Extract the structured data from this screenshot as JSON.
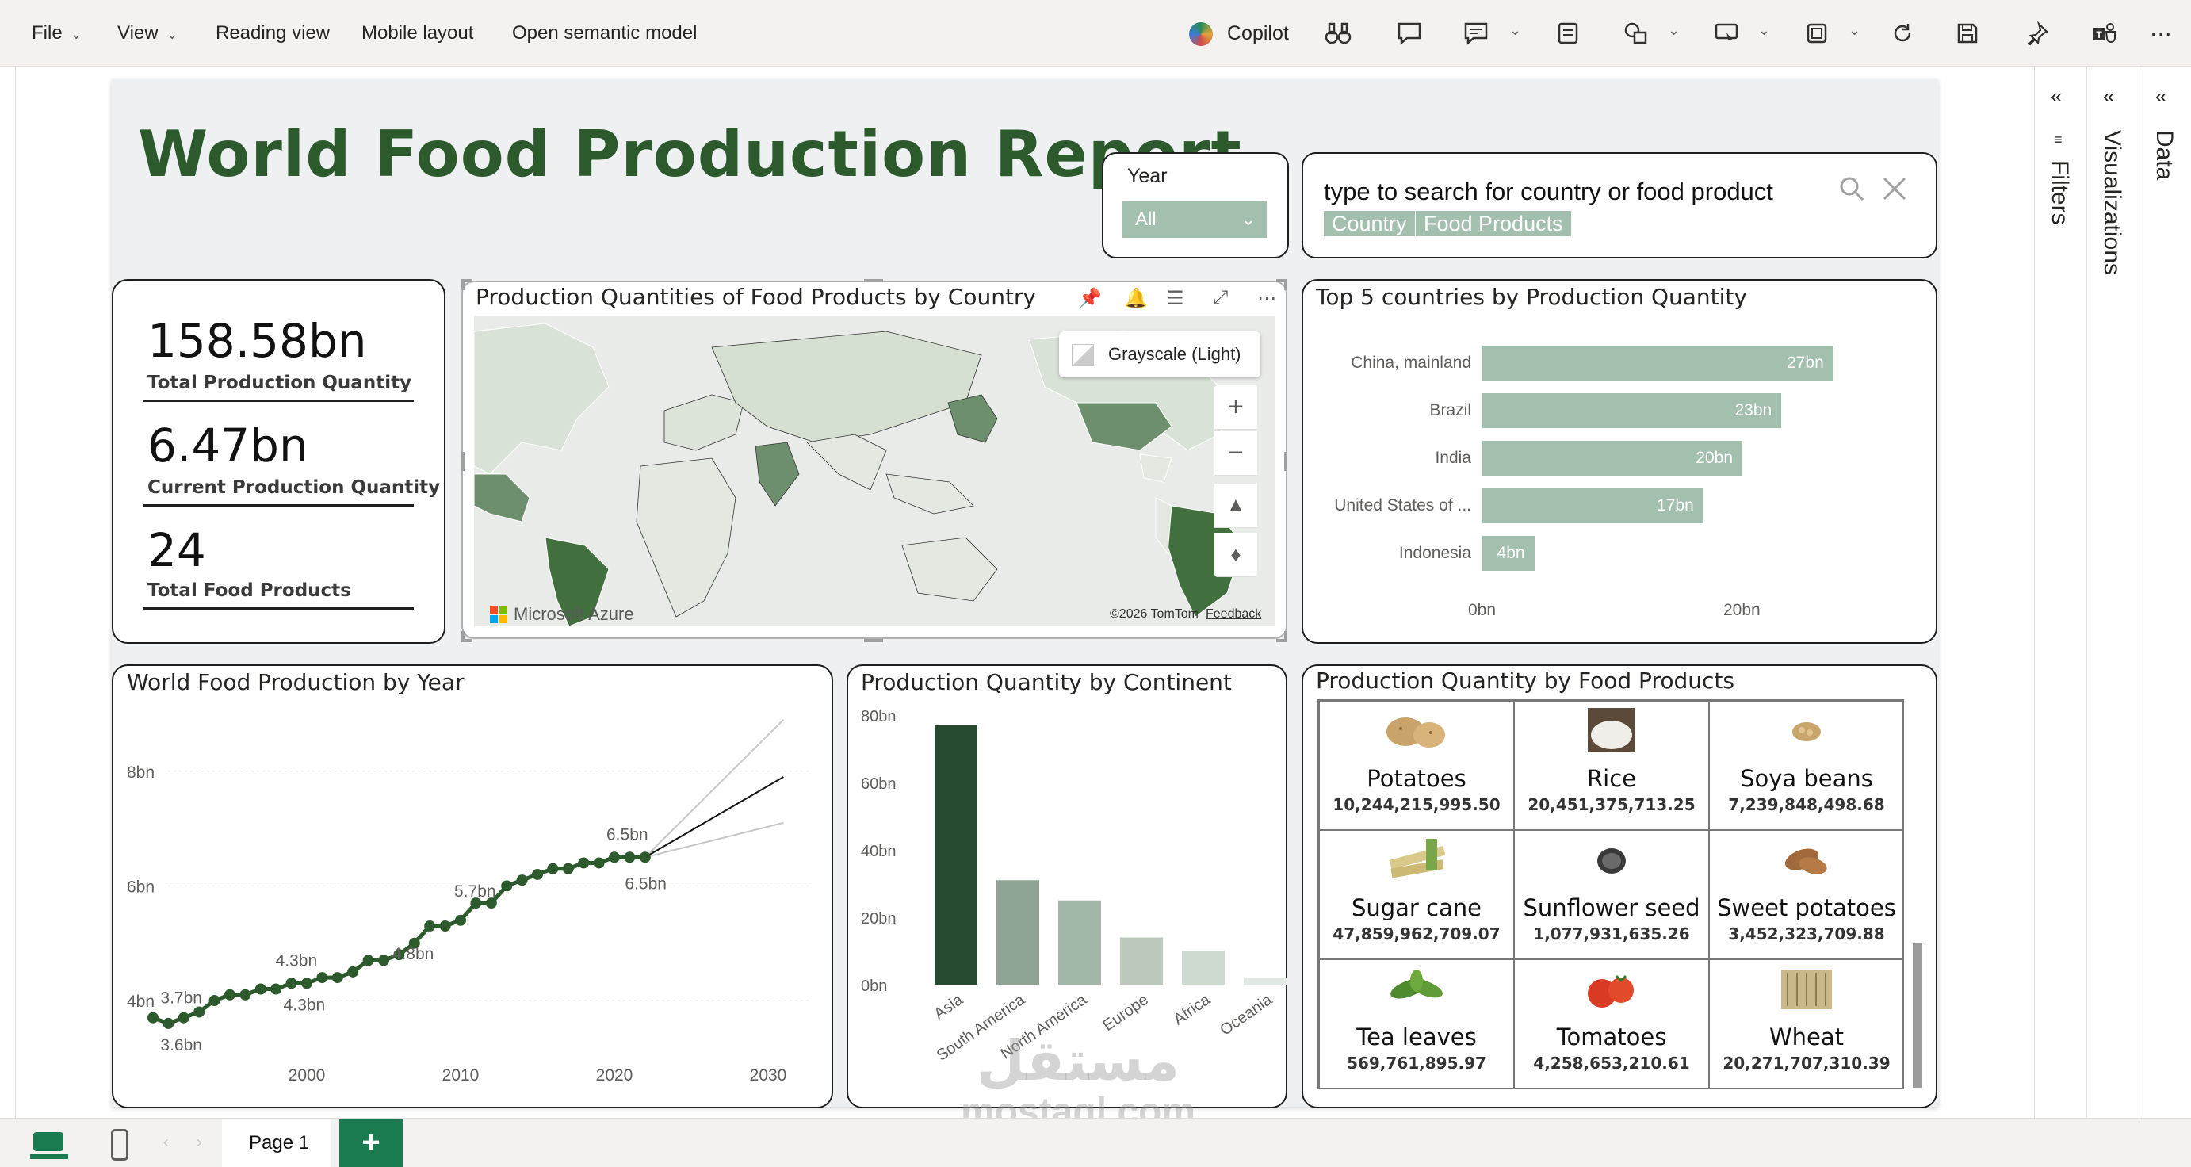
{
  "menu": {
    "file": "File",
    "view": "View",
    "reading_view": "Reading view",
    "mobile_layout": "Mobile layout",
    "open_semantic_model": "Open semantic model",
    "copilot": "Copilot"
  },
  "report": {
    "title": "World Food Production Report"
  },
  "year_slicer": {
    "label": "Year",
    "selected": "All"
  },
  "search": {
    "placeholder": "type to search for country or food product",
    "chips": [
      "Country",
      "Food Products"
    ]
  },
  "kpis": [
    {
      "value": "158.58bn",
      "label": "Total Production Quantity"
    },
    {
      "value": "6.47bn",
      "label": "Current Production Quantity"
    },
    {
      "value": "24",
      "label": "Total Food Products"
    }
  ],
  "map": {
    "title": "Production Quantities of Food Products by Country",
    "style_label": "Grayscale (Light)",
    "azure": "Microsoft Azure",
    "copyright": "©2026 TomTom",
    "feedback": "Feedback",
    "icons": [
      "pin-icon",
      "bell-icon",
      "filter-icon",
      "focus-mode-icon",
      "more-options-icon"
    ]
  },
  "top5": {
    "title": "Top 5 countries by Production Quantity",
    "axis_ticks": [
      "0bn",
      "20bn"
    ]
  },
  "line_chart": {
    "title": "World Food Production by Year",
    "y_ticks": [
      "8bn",
      "6bn",
      "4bn"
    ],
    "x_ticks": [
      "2000",
      "2010",
      "2020",
      "2030"
    ],
    "labels": [
      "3.7bn",
      "3.6bn",
      "4.3bn",
      "4.3bn",
      "4.8bn",
      "5.7bn",
      "6.5bn",
      "6.5bn"
    ]
  },
  "continent_chart": {
    "title": "Production Quantity by Continent",
    "y_ticks": [
      "80bn",
      "60bn",
      "40bn",
      "20bn",
      "0bn"
    ]
  },
  "food_products": {
    "title": "Production Quantity by Food Products",
    "items": [
      {
        "name": "Potatoes",
        "value": "10,244,215,995.50",
        "icon": "potato-icon"
      },
      {
        "name": "Rice",
        "value": "20,451,375,713.25",
        "icon": "rice-icon"
      },
      {
        "name": "Soya beans",
        "value": "7,239,848,498.68",
        "icon": "soybean-icon"
      },
      {
        "name": "Sugar cane",
        "value": "47,859,962,709.07",
        "icon": "sugarcane-icon"
      },
      {
        "name": "Sunflower seed",
        "value": "1,077,931,635.26",
        "icon": "sunflower-seed-icon"
      },
      {
        "name": "Sweet potatoes",
        "value": "3,452,323,709.88",
        "icon": "sweet-potato-icon"
      },
      {
        "name": "Tea leaves",
        "value": "569,761,895.97",
        "icon": "tea-leaves-icon"
      },
      {
        "name": "Tomatoes",
        "value": "4,258,653,210.61",
        "icon": "tomato-icon"
      },
      {
        "name": "Wheat",
        "value": "20,271,707,310.39",
        "icon": "wheat-icon"
      }
    ]
  },
  "panes": {
    "filters": "Filters",
    "visualizations": "Visualizations",
    "data": "Data"
  },
  "bottom": {
    "page_tab": "Page 1",
    "add_page": "+"
  },
  "watermark": {
    "line1": "مستقل",
    "line2": "mostaql.com"
  },
  "chart_data": [
    {
      "type": "bar",
      "title": "Top 5 countries by Production Quantity",
      "orientation": "horizontal",
      "categories": [
        "China, mainland",
        "Brazil",
        "India",
        "United States of ...",
        "Indonesia"
      ],
      "values": [
        27,
        23,
        20,
        17,
        4
      ],
      "value_labels": [
        "27bn",
        "23bn",
        "20bn",
        "17bn",
        "4bn"
      ],
      "xlim": [
        0,
        28
      ],
      "color": "#a3bfad"
    },
    {
      "type": "line",
      "title": "World Food Production by Year",
      "x": [
        1990,
        1991,
        1992,
        1993,
        1994,
        1995,
        1996,
        1997,
        1998,
        1999,
        2000,
        2001,
        2002,
        2003,
        2004,
        2005,
        2006,
        2007,
        2008,
        2009,
        2010,
        2011,
        2012,
        2013,
        2014,
        2015,
        2016,
        2017,
        2018,
        2019,
        2020,
        2021,
        2022
      ],
      "y": [
        3.7,
        3.6,
        3.7,
        3.8,
        4.0,
        4.1,
        4.1,
        4.2,
        4.2,
        4.3,
        4.3,
        4.4,
        4.4,
        4.5,
        4.7,
        4.7,
        4.8,
        5.0,
        5.3,
        5.3,
        5.4,
        5.7,
        5.7,
        6.0,
        6.1,
        6.2,
        6.3,
        6.3,
        6.4,
        6.4,
        6.5,
        6.5,
        6.5
      ],
      "forecast": {
        "x": [
          2022,
          2031
        ],
        "y": [
          6.5,
          7.9
        ],
        "upper": [
          6.5,
          8.9
        ],
        "lower": [
          6.5,
          7.1
        ]
      },
      "xlim": [
        1987,
        2034
      ],
      "ylim": [
        3.3,
        8.8
      ],
      "color": "#2d5a2d"
    },
    {
      "type": "bar",
      "title": "Production Quantity by Continent",
      "categories": [
        "Asia",
        "South America",
        "North America",
        "Europe",
        "Africa",
        "Oceania"
      ],
      "values": [
        77,
        31,
        25,
        14,
        10,
        2
      ],
      "ylim": [
        0,
        80
      ],
      "colors": [
        "#264a30",
        "#8fa495",
        "#a3b7a8",
        "#bccabd",
        "#cfdbd1",
        "#e2e8e3"
      ]
    }
  ]
}
